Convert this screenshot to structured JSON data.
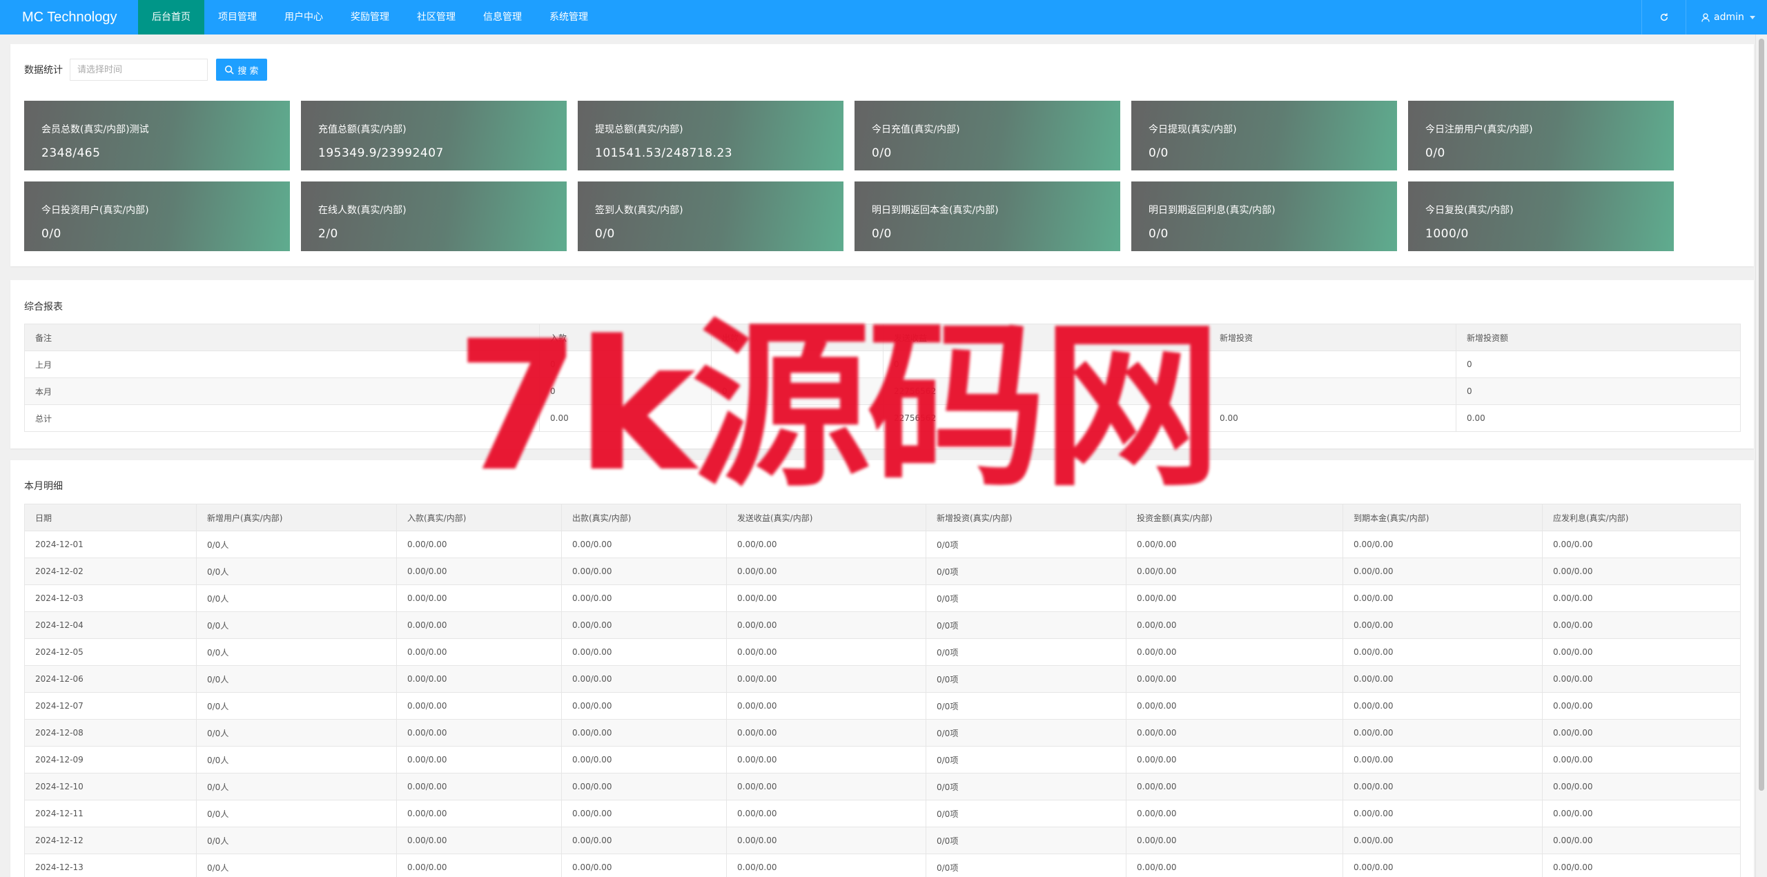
{
  "app": {
    "logo": "MC Technology"
  },
  "nav": [
    {
      "label": "后台首页",
      "active": true
    },
    {
      "label": "项目管理"
    },
    {
      "label": "用户中心"
    },
    {
      "label": "奖励管理"
    },
    {
      "label": "社区管理"
    },
    {
      "label": "信息管理"
    },
    {
      "label": "系统管理"
    }
  ],
  "user": {
    "name": "admin"
  },
  "filter": {
    "label": "数据统计",
    "placeholder": "请选择时间",
    "search_label": "搜 索"
  },
  "stats": [
    {
      "label": "会员总数(真实/内部)测试",
      "value": "2348/465"
    },
    {
      "label": "充值总额(真实/内部)",
      "value": "195349.9/23992407"
    },
    {
      "label": "提现总额(真实/内部)",
      "value": "101541.53/248718.23"
    },
    {
      "label": "今日充值(真实/内部)",
      "value": "0/0"
    },
    {
      "label": "今日提现(真实/内部)",
      "value": "0/0"
    },
    {
      "label": "今日注册用户(真实/内部)",
      "value": "0/0"
    },
    {
      "label": "今日投资用户(真实/内部)",
      "value": "0/0"
    },
    {
      "label": "在线人数(真实/内部)",
      "value": "2/0"
    },
    {
      "label": "签到人数(真实/内部)",
      "value": "0/0"
    },
    {
      "label": "明日到期返回本金(真实/内部)",
      "value": "0/0"
    },
    {
      "label": "明日到期返回利息(真实/内部)",
      "value": "0/0"
    },
    {
      "label": "今日复投(真实/内部)",
      "value": "1000/0"
    }
  ],
  "report": {
    "title": "综合报表",
    "headers": [
      "备注",
      "入款",
      "出款",
      "发送收益",
      "新增投资",
      "新增投资额"
    ],
    "rows": [
      [
        "上月",
        "0",
        "",
        "0",
        "",
        "0"
      ],
      [
        "本月",
        "0",
        "0",
        "22756562",
        "",
        "0"
      ],
      [
        "总计",
        "0.00",
        "",
        "22756562",
        "0.00",
        "0.00"
      ]
    ]
  },
  "monthly": {
    "title": "本月明细",
    "headers": [
      "日期",
      "新增用户(真实/内部)",
      "入款(真实/内部)",
      "出款(真实/内部)",
      "发送收益(真实/内部)",
      "新增投资(真实/内部)",
      "投资金额(真实/内部)",
      "到期本金(真实/内部)",
      "应发利息(真实/内部)"
    ],
    "rows": [
      [
        "2024-12-01",
        "0/0人",
        "0.00/0.00",
        "0.00/0.00",
        "0.00/0.00",
        "0/0项",
        "0.00/0.00",
        "0.00/0.00",
        "0.00/0.00"
      ],
      [
        "2024-12-02",
        "0/0人",
        "0.00/0.00",
        "0.00/0.00",
        "0.00/0.00",
        "0/0项",
        "0.00/0.00",
        "0.00/0.00",
        "0.00/0.00"
      ],
      [
        "2024-12-03",
        "0/0人",
        "0.00/0.00",
        "0.00/0.00",
        "0.00/0.00",
        "0/0项",
        "0.00/0.00",
        "0.00/0.00",
        "0.00/0.00"
      ],
      [
        "2024-12-04",
        "0/0人",
        "0.00/0.00",
        "0.00/0.00",
        "0.00/0.00",
        "0/0项",
        "0.00/0.00",
        "0.00/0.00",
        "0.00/0.00"
      ],
      [
        "2024-12-05",
        "0/0人",
        "0.00/0.00",
        "0.00/0.00",
        "0.00/0.00",
        "0/0项",
        "0.00/0.00",
        "0.00/0.00",
        "0.00/0.00"
      ],
      [
        "2024-12-06",
        "0/0人",
        "0.00/0.00",
        "0.00/0.00",
        "0.00/0.00",
        "0/0项",
        "0.00/0.00",
        "0.00/0.00",
        "0.00/0.00"
      ],
      [
        "2024-12-07",
        "0/0人",
        "0.00/0.00",
        "0.00/0.00",
        "0.00/0.00",
        "0/0项",
        "0.00/0.00",
        "0.00/0.00",
        "0.00/0.00"
      ],
      [
        "2024-12-08",
        "0/0人",
        "0.00/0.00",
        "0.00/0.00",
        "0.00/0.00",
        "0/0项",
        "0.00/0.00",
        "0.00/0.00",
        "0.00/0.00"
      ],
      [
        "2024-12-09",
        "0/0人",
        "0.00/0.00",
        "0.00/0.00",
        "0.00/0.00",
        "0/0项",
        "0.00/0.00",
        "0.00/0.00",
        "0.00/0.00"
      ],
      [
        "2024-12-10",
        "0/0人",
        "0.00/0.00",
        "0.00/0.00",
        "0.00/0.00",
        "0/0项",
        "0.00/0.00",
        "0.00/0.00",
        "0.00/0.00"
      ],
      [
        "2024-12-11",
        "0/0人",
        "0.00/0.00",
        "0.00/0.00",
        "0.00/0.00",
        "0/0项",
        "0.00/0.00",
        "0.00/0.00",
        "0.00/0.00"
      ],
      [
        "2024-12-12",
        "0/0人",
        "0.00/0.00",
        "0.00/0.00",
        "0.00/0.00",
        "0/0项",
        "0.00/0.00",
        "0.00/0.00",
        "0.00/0.00"
      ],
      [
        "2024-12-13",
        "0/0人",
        "0.00/0.00",
        "0.00/0.00",
        "0.00/0.00",
        "0/0项",
        "0.00/0.00",
        "0.00/0.00",
        "0.00/0.00"
      ]
    ]
  },
  "watermark": "7k源码网",
  "colors": {
    "topbar": "#1e9fff",
    "nav_active": "#009688",
    "watermark": "#e8102c"
  }
}
